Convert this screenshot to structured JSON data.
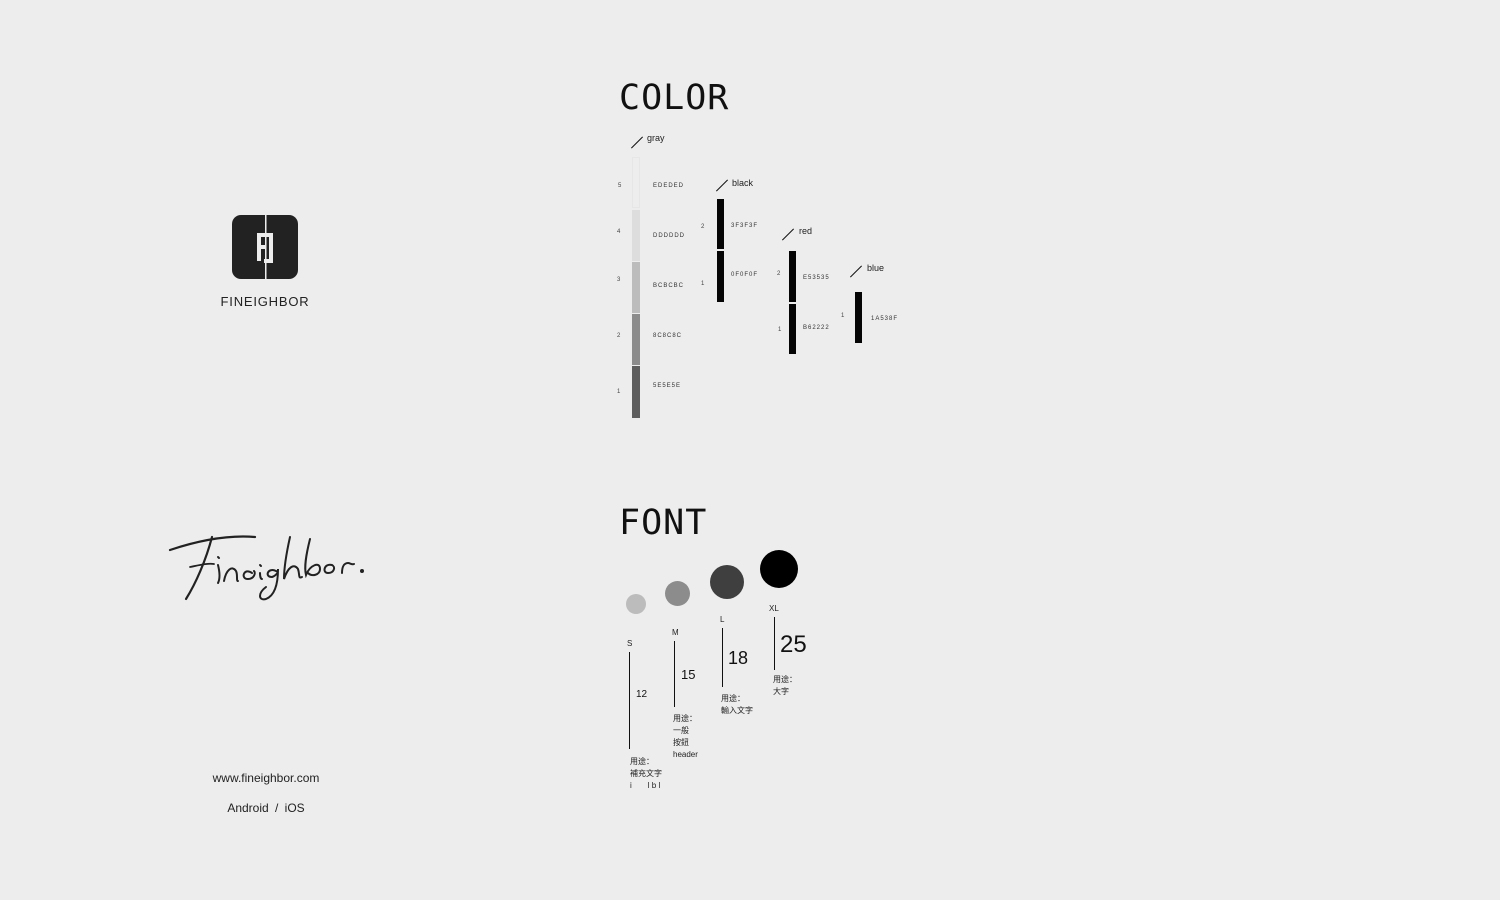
{
  "brand": {
    "name": "FINEIGHBOR",
    "signature_text": "Fineighbor.",
    "website": "www.fineighbor.com",
    "platforms": "Android / iOS"
  },
  "color_section": {
    "heading": "COLOR",
    "groups": [
      {
        "name": "gray",
        "swatches": [
          {
            "index": "5",
            "hex": "EDEDED",
            "color": "#EDEDED"
          },
          {
            "index": "4",
            "hex": "DDDDDD",
            "color": "#DDDDDD"
          },
          {
            "index": "3",
            "hex": "BCBCBC",
            "color": "#BCBCBC"
          },
          {
            "index": "2",
            "hex": "8C8C8C",
            "color": "#8C8C8C"
          },
          {
            "index": "1",
            "hex": "5E5E5E",
            "color": "#5E5E5E"
          }
        ]
      },
      {
        "name": "black",
        "swatches": [
          {
            "index": "2",
            "hex": "3F3F3F",
            "color": "#3F3F3F"
          },
          {
            "index": "1",
            "hex": "0F0F0F",
            "color": "#0F0F0F"
          }
        ]
      },
      {
        "name": "red",
        "swatches": [
          {
            "index": "2",
            "hex": "E53535",
            "color": "#E53535"
          },
          {
            "index": "1",
            "hex": "B62222",
            "color": "#B62222"
          }
        ]
      },
      {
        "name": "blue",
        "swatches": [
          {
            "index": "1",
            "hex": "1A538F",
            "color": "#1A538F"
          }
        ]
      }
    ]
  },
  "font_section": {
    "heading": "FONT",
    "sizes": [
      {
        "tag": "S",
        "size": "12",
        "usage": [
          "用途：",
          "補充文字",
          "i　　l b l"
        ],
        "dot_color": "#BCBCBC"
      },
      {
        "tag": "M",
        "size": "15",
        "usage": [
          "用途：",
          "一般",
          "按鈕",
          "header"
        ],
        "dot_color": "#8C8C8C"
      },
      {
        "tag": "L",
        "size": "18",
        "usage": [
          "用途：",
          "輸入文字"
        ],
        "dot_color": "#3F3F3F"
      },
      {
        "tag": "XL",
        "size": "25",
        "usage": [
          "用途：",
          "大字"
        ],
        "dot_color": "#000000"
      }
    ]
  }
}
